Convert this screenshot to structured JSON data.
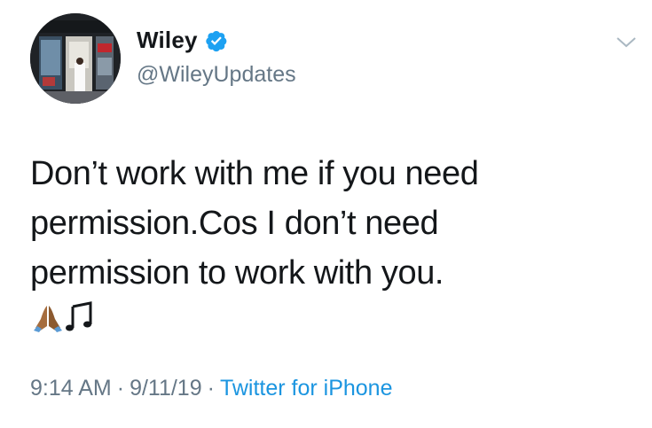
{
  "user": {
    "display_name": "Wiley",
    "handle": "@WileyUpdates",
    "verified": true,
    "verified_icon": "verified-badge-icon",
    "avatar": "profile-photo-storefront"
  },
  "tweet": {
    "line1": "Don’t work with me if you need",
    "line2": "permission.Cos I don’t need",
    "line3": "permission to work with you.",
    "emojis": [
      "folded-hands-icon",
      "musical-notes-icon"
    ]
  },
  "meta": {
    "time": "9:14 AM",
    "separator": "·",
    "date": "9/11/19",
    "source": "Twitter for iPhone"
  },
  "menu": {
    "icon": "chevron-down-icon"
  },
  "colors": {
    "text": "#14171a",
    "secondary": "#657786",
    "link": "#1b95e0",
    "verified": "#1da1f2"
  }
}
